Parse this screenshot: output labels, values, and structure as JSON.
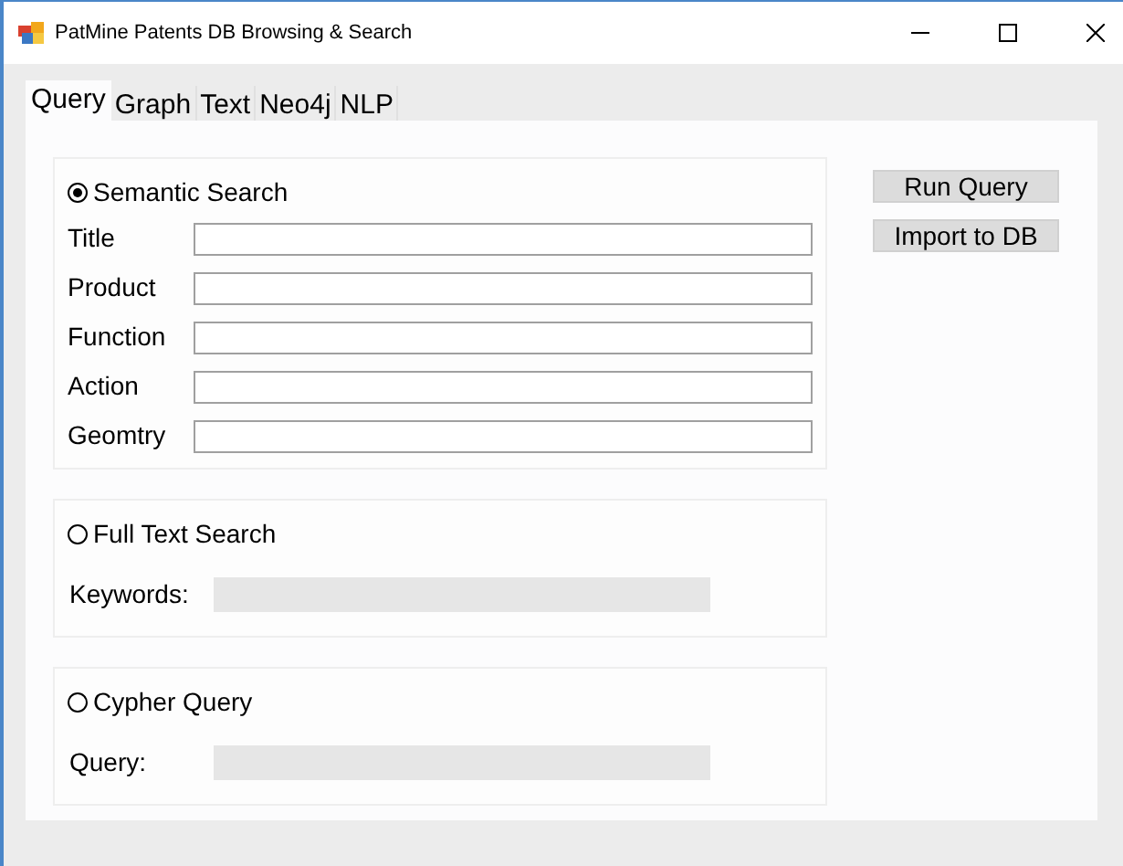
{
  "window": {
    "title": "PatMine Patents DB Browsing & Search"
  },
  "tabs": [
    {
      "label": "Query",
      "selected": true
    },
    {
      "label": "Graph",
      "selected": false
    },
    {
      "label": "Text",
      "selected": false
    },
    {
      "label": "Neo4j",
      "selected": false
    },
    {
      "label": "NLP",
      "selected": false
    }
  ],
  "sections": [
    {
      "label": "Semantic Search",
      "selected": true,
      "fields": [
        {
          "label": "Title",
          "disabled": false
        },
        {
          "label": "Product",
          "disabled": false
        },
        {
          "label": "Function",
          "disabled": false
        },
        {
          "label": "Action",
          "disabled": false
        },
        {
          "label": "Geomtry",
          "disabled": false
        }
      ]
    },
    {
      "label": "Full Text Search",
      "selected": false,
      "fields": [
        {
          "label": "Keywords:",
          "disabled": true
        }
      ]
    },
    {
      "label": "Cypher Query",
      "selected": false,
      "fields": [
        {
          "label": "Query:",
          "disabled": true
        }
      ]
    }
  ],
  "buttons": [
    "Run Query",
    "Import to DB"
  ]
}
